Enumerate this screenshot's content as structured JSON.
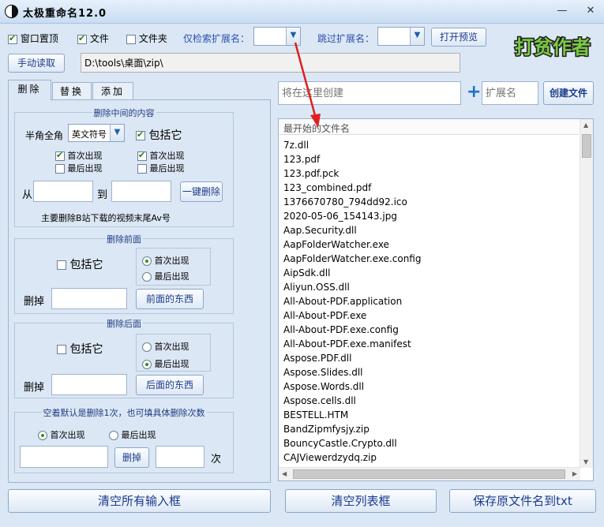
{
  "window": {
    "title": "太极重命名12.0",
    "minimize": "—",
    "close": "✕"
  },
  "toolbar": {
    "cb_pin": "窗口置顶",
    "cb_file": "文件",
    "cb_folder": "文件夹",
    "only_ext_label": "仅检索扩展名：",
    "only_ext_value": "",
    "skip_ext_label": "跳过扩展名：",
    "skip_ext_value": "",
    "preview_button": "打开预览",
    "manual_read_button": "手动读取",
    "path": "D:\\tools\\桌面\\zip\\",
    "logo_text": "打贫作者"
  },
  "tabs": [
    "删除",
    "替换",
    "添加"
  ],
  "delete_middle": {
    "title": "删除中间的内容",
    "width_label": "半角全角",
    "width_value": "英文符号",
    "include": "包括它",
    "first_a": "首次出现",
    "last_a": "最后出现",
    "first_b": "首次出现",
    "last_b": "最后出现",
    "from_label": "从",
    "to_label": "到",
    "one_click_delete": "一键删除",
    "hint": "主要删除B站下载的视频末尾Av号"
  },
  "delete_front": {
    "title": "删除前面",
    "include": "包括它",
    "first": "首次出现",
    "last": "最后出现",
    "remove_label": "删掉",
    "button": "前面的东西"
  },
  "delete_back": {
    "title": "删除后面",
    "include": "包括它",
    "first": "首次出现",
    "last": "最后出现",
    "remove_label": "删掉",
    "button": "后面的东西"
  },
  "delete_count": {
    "title": "空着默认是删除1次，也可填具体删除次数",
    "first": "首次出现",
    "last": "最后出现",
    "delete_button": "删掉",
    "times_label": "次"
  },
  "create": {
    "name_placeholder": "将在这里创建",
    "plus": "+",
    "ext_placeholder": "扩展名",
    "button": "创建文件"
  },
  "list": {
    "header": "最开始的文件名",
    "items": [
      "7z.dll",
      "123.pdf",
      "123.pdf.pck",
      "123_combined.pdf",
      "1376670780_794dd92.ico",
      "2020-05-06_154143.jpg",
      "Aap.Security.dll",
      "AapFolderWatcher.exe",
      "AapFolderWatcher.exe.config",
      "AipSdk.dll",
      "Aliyun.OSS.dll",
      "All-About-PDF.application",
      "All-About-PDF.exe",
      "All-About-PDF.exe.config",
      "All-About-PDF.exe.manifest",
      "Aspose.PDF.dll",
      "Aspose.Slides.dll",
      "Aspose.Words.dll",
      "Aspose.cells.dll",
      "BESTELL.HTM",
      "BandZipmfysjy.zip",
      "BouncyCastle.Crypto.dll",
      "CAJViewerdzydq.zip"
    ]
  },
  "bottom": {
    "clear_inputs": "清空所有输入框",
    "clear_list": "清空列表框",
    "save_txt": "保存原文件名到txt"
  },
  "colors": {
    "accent": "#1a3a8c",
    "arrow": "#e02020",
    "check": "#2a7a1a"
  }
}
